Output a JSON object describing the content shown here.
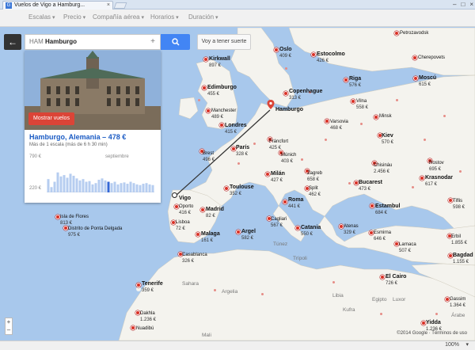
{
  "browser": {
    "tab_title": "Vuelos de Vigo a Hamburg...",
    "zoom_level": "100%"
  },
  "filters": [
    {
      "label": "Escalas"
    },
    {
      "label": "Precio"
    },
    {
      "label": "Compañía aérea"
    },
    {
      "label": "Horarios"
    },
    {
      "label": "Duración"
    }
  ],
  "search": {
    "code": "HAM",
    "city": "Hamburgo",
    "button_icon": "search-icon",
    "retry_label": "Voy a tener suerte"
  },
  "card": {
    "show_flights_label": "Mostrar vuelos",
    "title": "Hamburgo, Alemania – 478 €",
    "subtitle": "Más de 1 escala (más de 6 h 30 min)",
    "chart_top_label": "790 €",
    "chart_bottom_label": "220 €",
    "chart_month_label": "septiembre"
  },
  "chart_data": {
    "type": "bar",
    "ylim": [
      220,
      790
    ],
    "yticks": [
      "790 €",
      "220 €"
    ],
    "annotation": "septiembre",
    "values": [
      420,
      300,
      380,
      520,
      460,
      480,
      440,
      500,
      470,
      430,
      400,
      420,
      380,
      390,
      340,
      360,
      410,
      430,
      400,
      380,
      360,
      380,
      340,
      360,
      370,
      350,
      380,
      360,
      340,
      330,
      350,
      360,
      340,
      330
    ],
    "highlight_index": 19
  },
  "cities": [
    {
      "name": "Kirkwall",
      "price": "897 €"
    },
    {
      "name": "Oslo",
      "price": "409 €"
    },
    {
      "name": "Estocolmo",
      "price": "426 €"
    },
    {
      "name": "Petrozavodsk",
      "price": ""
    },
    {
      "name": "Edimburgo",
      "price": "455 €"
    },
    {
      "name": "Copenhague",
      "price": "313 €"
    },
    {
      "name": "Riga",
      "price": "576 €"
    },
    {
      "name": "Moscú",
      "price": "615 €"
    },
    {
      "name": "Cherepovets",
      "price": ""
    },
    {
      "name": "Manchester",
      "price": "489 €"
    },
    {
      "name": "Hamburgo",
      "price": ""
    },
    {
      "name": "Vilna",
      "price": "558 €"
    },
    {
      "name": "Londres",
      "price": "415 €"
    },
    {
      "name": "Varsovia",
      "price": "468 €"
    },
    {
      "name": "Minsk",
      "price": ""
    },
    {
      "name": "Brest",
      "price": "496 €"
    },
    {
      "name": "París",
      "price": "328 €"
    },
    {
      "name": "Fráncfort",
      "price": "425 €"
    },
    {
      "name": "Múnich",
      "price": "403 €"
    },
    {
      "name": "Kiev",
      "price": "570 €"
    },
    {
      "name": "Chisináu",
      "price": "2.456 €"
    },
    {
      "name": "Rostov",
      "price": "695 €"
    },
    {
      "name": "Zagreb",
      "price": "658 €"
    },
    {
      "name": "Milán",
      "price": "427 €"
    },
    {
      "name": "Split",
      "price": "462 €"
    },
    {
      "name": "Bucarest",
      "price": "473 €"
    },
    {
      "name": "Krasnodar",
      "price": "617 €"
    },
    {
      "name": "Vigo",
      "price": ""
    },
    {
      "name": "Toulouse",
      "price": "352 €"
    },
    {
      "name": "Roma",
      "price": "441 €"
    },
    {
      "name": "Oporto",
      "price": "416 €"
    },
    {
      "name": "Madrid",
      "price": "82 €"
    },
    {
      "name": "Estambul",
      "price": "684 €"
    },
    {
      "name": "Tiflis",
      "price": "598 €"
    },
    {
      "name": "Isla de Flores",
      "price": "813 €"
    },
    {
      "name": "Lisboa",
      "price": "72 €"
    },
    {
      "name": "Cagliari",
      "price": "567 €"
    },
    {
      "name": "Atenas",
      "price": "329 €"
    },
    {
      "name": "Esmirna",
      "price": "646 €"
    },
    {
      "name": "Distrito de Ponta Delgada",
      "price": "975 €"
    },
    {
      "name": "Malaga",
      "price": "161 €"
    },
    {
      "name": "Argel",
      "price": "582 €"
    },
    {
      "name": "Catania",
      "price": "550 €"
    },
    {
      "name": "Erbil",
      "price": "1.855 €"
    },
    {
      "name": "Larnaca",
      "price": "507 €"
    },
    {
      "name": "Casablanca",
      "price": "326 €"
    },
    {
      "name": "Bagdad",
      "price": "1.155 €"
    },
    {
      "name": "El Cairo",
      "price": "726 €"
    },
    {
      "name": "Tenerife",
      "price": "359 €"
    },
    {
      "name": "Gassim",
      "price": "1.364 €"
    },
    {
      "name": "Dakhla",
      "price": "1.236 €"
    },
    {
      "name": "Nuadibú",
      "price": ""
    },
    {
      "name": "Yidda",
      "price": "1.236 €"
    }
  ],
  "countries": [
    "Túnez",
    "Trípoli",
    "Argelia",
    "Mali",
    "Libia",
    "Egipto",
    "Árabe",
    "Luxor",
    "Kufra",
    "Sahara"
  ],
  "map_credit": "©2014 Google · Términos de uso"
}
